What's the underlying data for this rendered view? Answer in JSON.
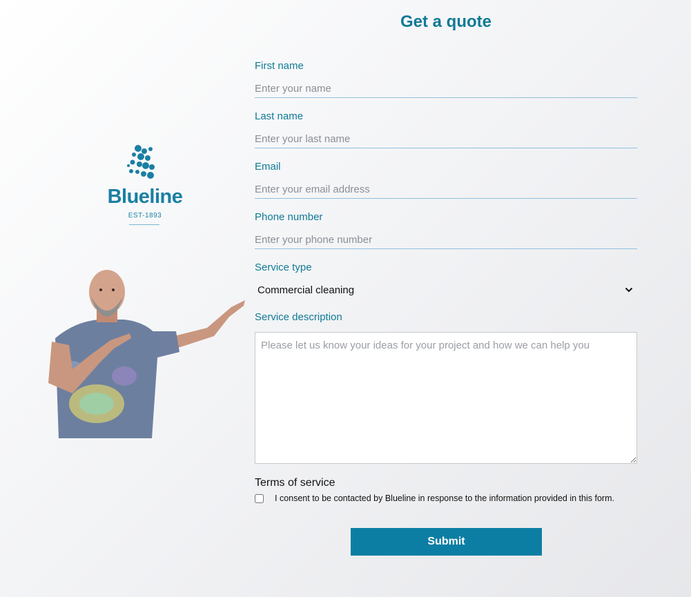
{
  "form": {
    "title": "Get a quote",
    "first_name": {
      "label": "First name",
      "placeholder": "Enter your name",
      "value": ""
    },
    "last_name": {
      "label": "Last name",
      "placeholder": "Enter your last name",
      "value": ""
    },
    "email": {
      "label": "Email",
      "placeholder": "Enter your email address",
      "value": ""
    },
    "phone": {
      "label": "Phone number",
      "placeholder": "Enter your phone number",
      "value": ""
    },
    "service_type": {
      "label": "Service type",
      "selected": "Commercial cleaning"
    },
    "service_description": {
      "label": "Service description",
      "placeholder": "Please let us know your ideas for your project and how we can help you"
    },
    "terms": {
      "title": "Terms of service",
      "consent_text": "I consent to be contacted by Blueline in response to the information provided in this form.",
      "checked": false
    },
    "submit_label": "Submit"
  },
  "brand": {
    "name": "Blueline",
    "established": "EST-1893",
    "accent_color": "#117a96"
  },
  "icons": {
    "logo_mark": "dots-cluster-icon",
    "select_arrow": "chevron-down-icon"
  }
}
